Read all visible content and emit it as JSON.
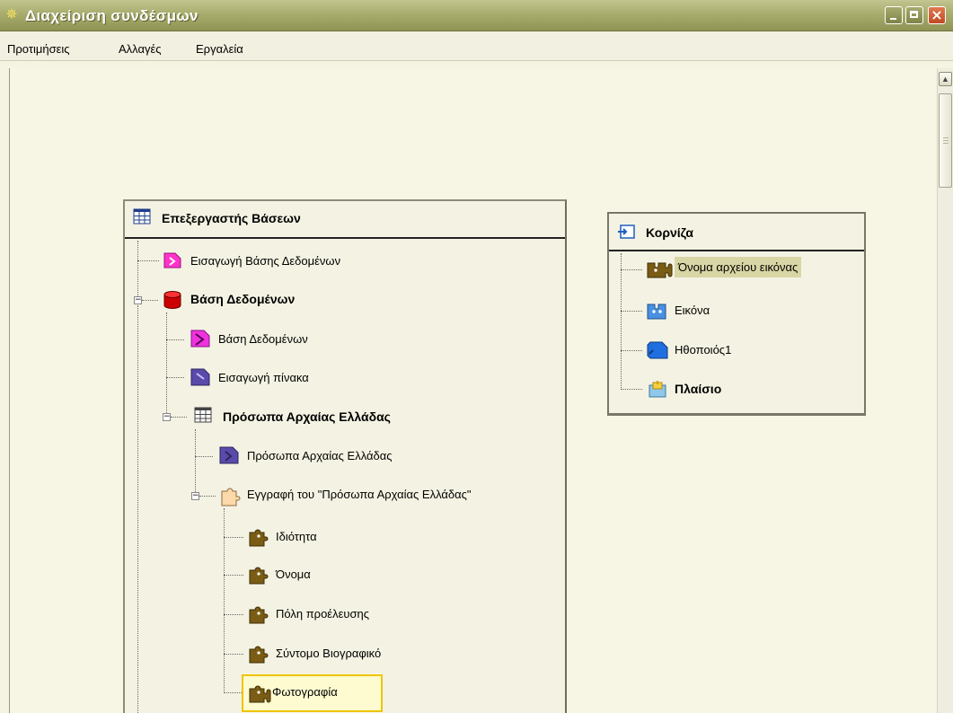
{
  "window": {
    "title": "Διαχείριση συνδέσμων",
    "controls": {
      "minimize": "minimize",
      "maximize": "maximize",
      "close": "close"
    }
  },
  "menu": [
    {
      "label": "Προτιμήσεις"
    },
    {
      "label": "Αλλαγές"
    },
    {
      "label": "Εργαλεία"
    }
  ],
  "db_panel": {
    "title": "Επεξεργαστής Βάσεων",
    "tree": {
      "import_db": "Εισαγωγή Βάσης Δεδομένων",
      "database": "Βάση Δεδομένων",
      "database_child": "Βάση Δεδομένων",
      "import_table": "Εισαγωγή πίνακα",
      "table": "Πρόσωπα Αρχαίας Ελλάδας",
      "table_child": "Πρόσωπα Αρχαίας Ελλάδας",
      "record": "Εγγραφή του \"Πρόσωπα Αρχαίας Ελλάδας\"",
      "fields": [
        {
          "label": "Ιδιότητα"
        },
        {
          "label": "Όνομα"
        },
        {
          "label": "Πόλη προέλευσης"
        },
        {
          "label": "Σύντομο Βιογραφικό"
        },
        {
          "label": "Φωτογραφία",
          "selected": true
        }
      ]
    }
  },
  "frame_panel": {
    "title": "Κορνίζα",
    "items": [
      {
        "label": "Όνομα αρχείου εικόνας",
        "highlighted": true
      },
      {
        "label": "Εικόνα"
      },
      {
        "label": "Ηθοποιός1"
      },
      {
        "label": "Πλαίσιο",
        "bold": true
      }
    ]
  },
  "icons": {
    "app": "app-icon",
    "db_editor": "table-grid-icon",
    "import_db": "pink-connector-icon",
    "database": "red-cylinder-icon",
    "database_child": "magenta-connector-icon",
    "import_table": "purple-connector-icon",
    "table": "table-grid-icon",
    "table_child": "purple-connector-icon",
    "record": "peach-puzzle-icon",
    "field": "brown-puzzle-icon",
    "frame": "frame-import-icon",
    "frame_image_name": "brown-puzzle-icon",
    "frame_image": "blue-puzzle-icon",
    "frame_actor": "blue-connector-icon",
    "frame_box": "sticky-frame-icon"
  },
  "colors": {
    "title_bar": "#a8ac6c",
    "background": "#f5f4e3",
    "selection_border": "#f0c400",
    "highlight": "#d9d6a5"
  }
}
